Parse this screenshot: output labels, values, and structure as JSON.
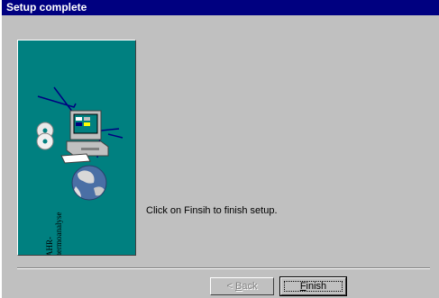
{
  "window": {
    "title": "Setup complete"
  },
  "panel": {
    "brand_line1": "BAHR-",
    "brand_line2": "Thermoanalyse",
    "background_color": "#008080",
    "illustration": [
      "computer-icon",
      "cd-disc-icon",
      "globe-icon"
    ]
  },
  "main": {
    "message": "Click on Finsih to finish setup."
  },
  "buttons": {
    "back_prefix": "< ",
    "back_mnemonic": "B",
    "back_rest": "ack",
    "back_enabled": false,
    "finish_mnemonic": "F",
    "finish_rest": "inish"
  },
  "colors": {
    "title_bar": "#000080",
    "dialog_face": "#c0c0c0"
  }
}
